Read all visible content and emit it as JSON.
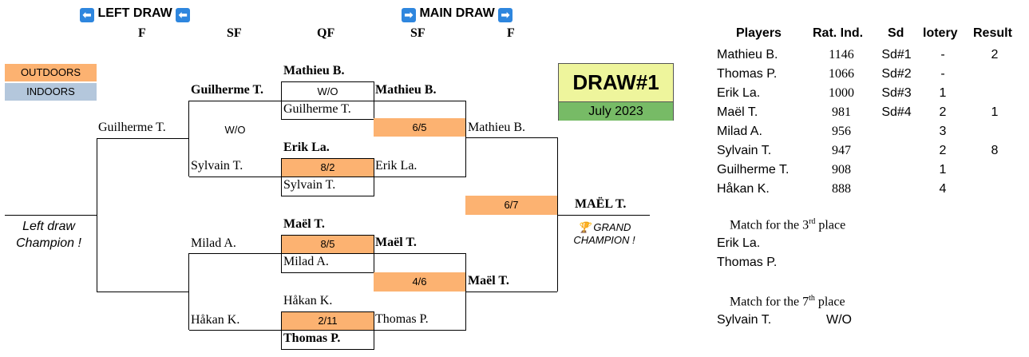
{
  "headers": {
    "left_draw": "LEFT DRAW",
    "main_draw": "MAIN DRAW",
    "left_arrow_icon": "left-arrow-icon",
    "right_arrow_icon": "right-arrow-icon",
    "rounds": [
      "F",
      "SF",
      "QF",
      "SF",
      "F"
    ]
  },
  "legend": {
    "outdoors": "OUTDOORS",
    "indoors": "INDOORS",
    "outdoors_color": "#fcb271",
    "indoors_color": "#b4c7dc"
  },
  "draw_box": {
    "title": "DRAW#1",
    "date": "July 2023",
    "title_color": "#eef59c",
    "date_color": "#77bb66"
  },
  "main_draw": {
    "qf": [
      {
        "top": "Mathieu B.",
        "score": "W/O",
        "bottom": "Guilherme T."
      },
      {
        "top": "Erik La.",
        "score": "8/2",
        "bottom": "Sylvain T."
      },
      {
        "top": "Maël T.",
        "score": "8/5",
        "bottom": "Milad A."
      },
      {
        "top": "Håkan K.",
        "score": "2/11",
        "bottom": "Thomas P."
      }
    ],
    "sf": [
      {
        "top": "Mathieu B.",
        "score": "6/5",
        "bottom": "Erik La."
      },
      {
        "top": "Maël T.",
        "score": "4/6",
        "bottom": "Thomas P."
      }
    ],
    "final": {
      "top": "Mathieu B.",
      "score": "6/7",
      "bottom": "Maël T."
    },
    "champion": "MAËL T.",
    "champion_label_line1": "GRAND",
    "champion_label_line2": "CHAMPION !",
    "trophy_icon": "trophy-icon"
  },
  "left_draw": {
    "sf": [
      {
        "top": "Guilherme T.",
        "bottom": "Sylvain T."
      },
      {
        "top": "Milad A.",
        "bottom": "Håkan K."
      }
    ],
    "sf_score": "W/O",
    "final_top": "Guilherme T.",
    "champion_line1": "Left draw",
    "champion_line2": "Champion !"
  },
  "players_table": {
    "headers": [
      "Players",
      "Rat. Ind.",
      "Sd",
      "lotery",
      "Result"
    ],
    "rows": [
      {
        "name": "Mathieu B.",
        "rating": "1146",
        "seed": "Sd#1",
        "lotery": "-",
        "result": "2"
      },
      {
        "name": "Thomas P.",
        "rating": "1066",
        "seed": "Sd#2",
        "lotery": "-",
        "result": ""
      },
      {
        "name": "Erik La.",
        "rating": "1000",
        "seed": "Sd#3",
        "lotery": "1",
        "result": ""
      },
      {
        "name": "Maël T.",
        "rating": "981",
        "seed": "Sd#4",
        "lotery": "2",
        "result": "1"
      },
      {
        "name": "Milad A.",
        "rating": "956",
        "seed": "",
        "lotery": "3",
        "result": ""
      },
      {
        "name": "Sylvain T.",
        "rating": "947",
        "seed": "",
        "lotery": "2",
        "result": "8"
      },
      {
        "name": "Guilherme T.",
        "rating": "908",
        "seed": "",
        "lotery": "1",
        "result": ""
      },
      {
        "name": "Håkan K.",
        "rating": "888",
        "seed": "",
        "lotery": "4",
        "result": ""
      }
    ]
  },
  "third_place": {
    "title_prefix": "Match for the 3",
    "title_sup": "rd",
    "title_suffix": " place",
    "player1": "Erik La.",
    "player2": "Thomas P."
  },
  "seventh_place": {
    "title_prefix": "Match for the 7",
    "title_sup": "th",
    "title_suffix": " place",
    "player": "Sylvain T.",
    "result": "W/O"
  }
}
